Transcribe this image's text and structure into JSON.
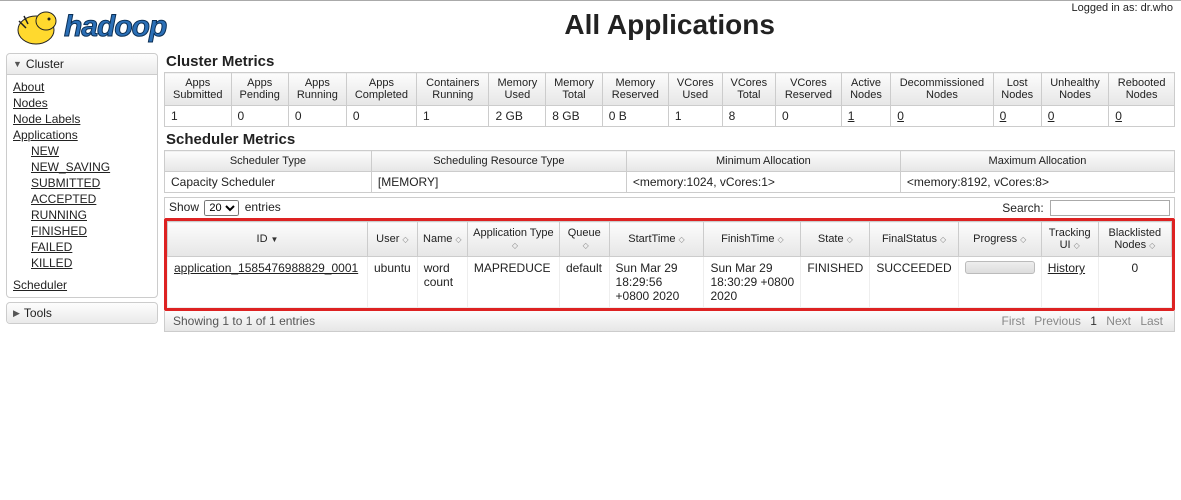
{
  "login_text": "Logged in as: dr.who",
  "page_title": "All Applications",
  "logo_alt": "hadoop",
  "sidebar": {
    "cluster": {
      "title": "Cluster",
      "about": "About",
      "nodes": "Nodes",
      "node_labels": "Node Labels",
      "applications": "Applications",
      "states": [
        "NEW",
        "NEW_SAVING",
        "SUBMITTED",
        "ACCEPTED",
        "RUNNING",
        "FINISHED",
        "FAILED",
        "KILLED"
      ],
      "scheduler": "Scheduler"
    },
    "tools": {
      "title": "Tools"
    }
  },
  "cluster_metrics": {
    "title": "Cluster Metrics",
    "headers": [
      "Apps Submitted",
      "Apps Pending",
      "Apps Running",
      "Apps Completed",
      "Containers Running",
      "Memory Used",
      "Memory Total",
      "Memory Reserved",
      "VCores Used",
      "VCores Total",
      "VCores Reserved",
      "Active Nodes",
      "Decommissioned Nodes",
      "Lost Nodes",
      "Unhealthy Nodes",
      "Rebooted Nodes"
    ],
    "values": [
      "1",
      "0",
      "0",
      "0",
      "1",
      "2 GB",
      "8 GB",
      "0 B",
      "1",
      "8",
      "0",
      "1",
      "0",
      "0",
      "0",
      "0"
    ]
  },
  "scheduler_metrics": {
    "title": "Scheduler Metrics",
    "headers": [
      "Scheduler Type",
      "Scheduling Resource Type",
      "Minimum Allocation",
      "Maximum Allocation"
    ],
    "values": [
      "Capacity Scheduler",
      "[MEMORY]",
      "<memory:1024, vCores:1>",
      "<memory:8192, vCores:8>"
    ]
  },
  "table_ctrl": {
    "show": "Show",
    "count": "20",
    "entries": "entries",
    "search": "Search:"
  },
  "apps": {
    "headers": [
      "ID",
      "User",
      "Name",
      "Application Type",
      "Queue",
      "StartTime",
      "FinishTime",
      "State",
      "FinalStatus",
      "Progress",
      "Tracking UI",
      "Blacklisted Nodes"
    ],
    "row": {
      "id": "application_1585476988829_0001",
      "user": "ubuntu",
      "name": "word count",
      "app_type": "MAPREDUCE",
      "queue": "default",
      "start": "Sun Mar 29 18:29:56 +0800 2020",
      "finish": "Sun Mar 29 18:30:29 +0800 2020",
      "state": "FINISHED",
      "final": "SUCCEEDED",
      "tracking": "History",
      "blacklisted": "0"
    }
  },
  "footer": {
    "info": "Showing 1 to 1 of 1 entries",
    "first": "First",
    "prev": "Previous",
    "page": "1",
    "next": "Next",
    "last": "Last"
  }
}
